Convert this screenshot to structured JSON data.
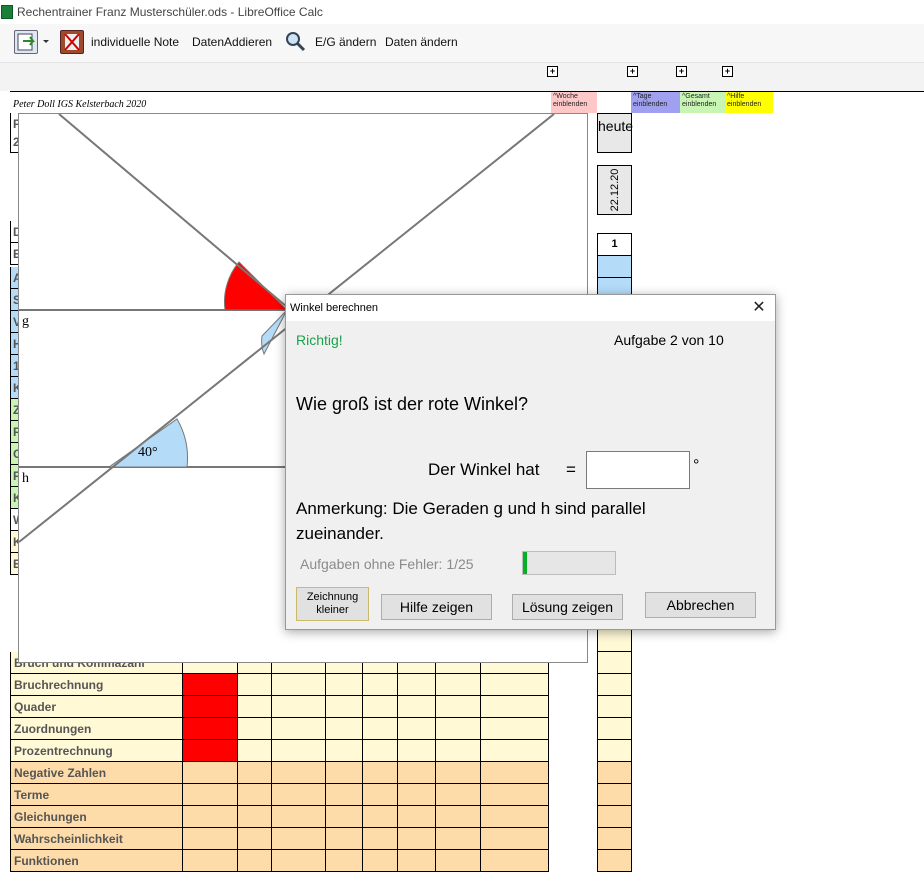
{
  "window": {
    "title": "Rechentrainer Franz Musterschüler.ods - LibreOffice Calc"
  },
  "toolbar": {
    "buttons": [
      "individuelle Note",
      "DatenAddieren",
      "E/G ändern",
      "Daten ändern"
    ]
  },
  "sheet": {
    "credit": "Peter Doll IGS Kelsterbach 2020",
    "expander_glyph": "+",
    "header_cells": {
      "woche": "^Woche einblenden",
      "tage": "^Tage einblenden",
      "gesamt": "^Gesamt einblenden",
      "hilfe": "^Hilfe einblenden"
    },
    "heute_label": "heute",
    "date_value": "22.12.20",
    "index_value": "1",
    "partial_left_labels": [
      "F",
      "2",
      "D",
      "E",
      "A",
      "S",
      "V",
      "H",
      "1",
      "K",
      "Z",
      "F",
      "G",
      "F",
      "K",
      "W",
      "K",
      "E"
    ],
    "row_labels": [
      "Bruch und Kommazahl",
      "Bruchrechnung",
      "Quader",
      "Zuordnungen",
      "Prozentrechnung",
      "Negative Zahlen",
      "Terme",
      "Gleichungen",
      "Wahrscheinlichkeit",
      "Funktionen"
    ],
    "colors": {
      "light_row": "#fff9d6",
      "orange_row": "#fddcaa",
      "red": "#ff0000",
      "blue": "#b4dcf8",
      "green_hdr": "#c8f5b4",
      "pink_hdr": "#ffc8c8",
      "purple_hdr": "#a0a0f0",
      "yellow_hdr": "#ffff00"
    }
  },
  "drawing": {
    "line_g_label": "g",
    "line_h_label": "h",
    "angle_label": "40°"
  },
  "dialog": {
    "title": "Winkel berechnen",
    "status": "Richtig!",
    "progress_text": "Aufgabe 2 von 10",
    "question": "Wie groß ist der rote Winkel?",
    "answer_label": "Der Winkel hat",
    "equals": "=",
    "answer_value": "",
    "degree_symbol": "°",
    "note_line1": "Anmerkung: Die Geraden g und h sind parallel",
    "note_line2": "zueinander.",
    "error_free_label": "Aufgaben ohne Fehler: 1/25",
    "error_free_fraction": 0.04,
    "buttons": {
      "smaller_line1": "Zeichnung",
      "smaller_line2": "kleiner",
      "help": "Hilfe zeigen",
      "solution": "Lösung zeigen",
      "cancel": "Abbrechen"
    },
    "close_glyph": "✕"
  }
}
